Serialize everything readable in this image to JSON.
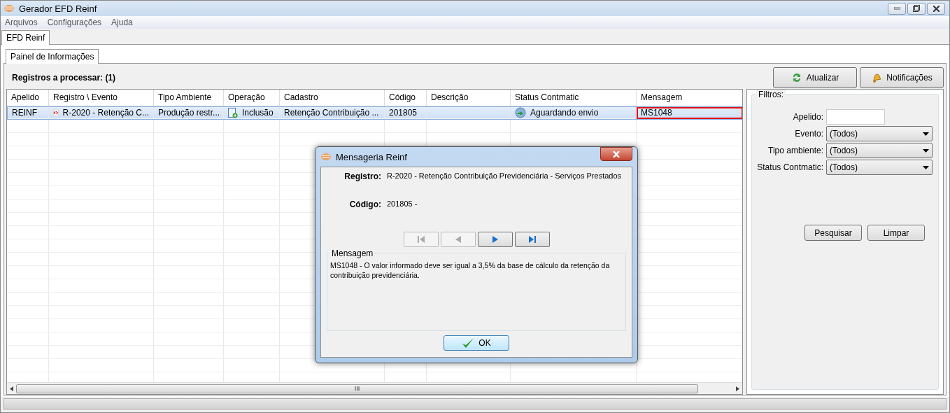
{
  "window": {
    "title": "Gerador EFD Reinf"
  },
  "menu": [
    {
      "label": "Arquivos"
    },
    {
      "label": "Configurações"
    },
    {
      "label": "Ajuda"
    }
  ],
  "tabs": [
    {
      "label": "EFD Reinf",
      "selected": true
    }
  ],
  "subtabs": [
    {
      "label": "Painel de Informações",
      "selected": true
    }
  ],
  "heading": "Registros a processar: (1)",
  "toolbar": [
    {
      "label": "Atualizar",
      "kind": "refresh"
    },
    {
      "label": "Notificações",
      "kind": "bell"
    }
  ],
  "table": {
    "columns": [
      "Apelido",
      "Registro \\ Evento",
      "Tipo Ambiente",
      "Operação",
      "Cadastro",
      "Código",
      "Descrição",
      "Status Contmatic",
      "Mensagem"
    ],
    "rows": [
      {
        "selected": true,
        "cells": [
          {
            "text": "REINF",
            "kind": "text"
          },
          {
            "text": "R-2020 - Retenção C...",
            "kind": "xml"
          },
          {
            "text": "Produção restr...",
            "kind": "text"
          },
          {
            "text": "Inclusão",
            "kind": "doc"
          },
          {
            "text": "Retenção Contribuição ...",
            "kind": "text"
          },
          {
            "text": "201805",
            "kind": "text"
          },
          {
            "text": "",
            "kind": "text"
          },
          {
            "text": "Aguardando envio",
            "kind": "status"
          },
          {
            "text": "MS1048",
            "kind": "text",
            "highlighted": true
          }
        ]
      }
    ]
  },
  "filters": {
    "title": "Filtros:",
    "fields": [
      {
        "label": "Apelido:",
        "kind": "input"
      },
      {
        "label": "Evento:",
        "kind": "select",
        "value": "(Todos)"
      },
      {
        "label": "Tipo ambiente:",
        "kind": "select",
        "value": "(Todos)"
      },
      {
        "label": "Status Contmatic:",
        "kind": "select",
        "value": "(Todos)"
      }
    ],
    "buttons": [
      {
        "label": "Pesquisar"
      },
      {
        "label": "Limpar"
      }
    ]
  },
  "dialog": {
    "title": "Mensageria Reinf",
    "fields": [
      {
        "label": "Registro:",
        "value": "R-2020 - Retenção Contribuição Previdenciária - Serviços Prestados"
      },
      {
        "label": "Código:",
        "value": "201805 -"
      }
    ],
    "nav": [
      {
        "kind": "first",
        "disabled": true
      },
      {
        "kind": "prev",
        "disabled": true
      },
      {
        "kind": "next",
        "disabled": false
      },
      {
        "kind": "last",
        "disabled": false
      }
    ],
    "message_title": "Mensagem",
    "message": "MS1048 - O valor informado deve ser igual a 3,5% da base de cálculo da retenção da contribuição previdenciária.",
    "ok": "OK"
  }
}
